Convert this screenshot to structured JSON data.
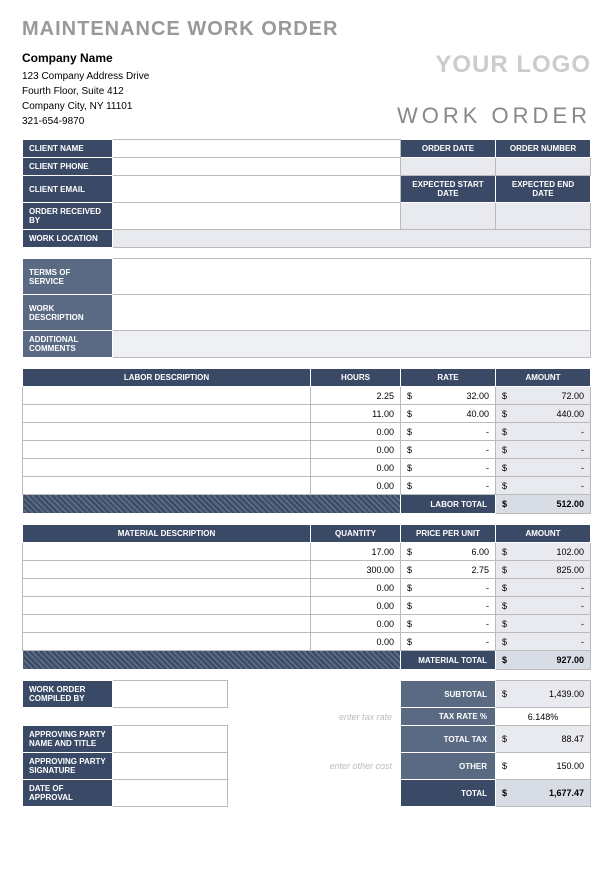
{
  "title": "MAINTENANCE WORK ORDER",
  "company": {
    "name": "Company Name",
    "addr1": "123 Company Address Drive",
    "addr2": "Fourth Floor, Suite 412",
    "addr3": "Company City, NY 11101",
    "phone": "321-654-9870"
  },
  "logo": "YOUR LOGO",
  "work_order": "WORK ORDER",
  "labels": {
    "client_name": "CLIENT NAME",
    "client_phone": "CLIENT PHONE",
    "client_email": "CLIENT EMAIL",
    "order_received": "ORDER RECEIVED BY",
    "work_location": "WORK LOCATION",
    "order_date": "ORDER DATE",
    "order_number": "ORDER NUMBER",
    "exp_start": "EXPECTED START DATE",
    "exp_end": "EXPECTED END DATE",
    "terms": "TERMS OF SERVICE",
    "work_desc": "WORK DESCRIPTION",
    "add_comments": "ADDITIONAL COMMENTS",
    "labor_desc": "LABOR DESCRIPTION",
    "hours": "HOURS",
    "rate": "RATE",
    "amount": "AMOUNT",
    "labor_total": "LABOR TOTAL",
    "material_desc": "MATERIAL DESCRIPTION",
    "quantity": "QUANTITY",
    "ppu": "PRICE PER UNIT",
    "material_total": "MATERIAL TOTAL",
    "compiled_by": "WORK ORDER COMPILED BY",
    "enter_tax": "enter tax rate",
    "enter_other": "enter other cost",
    "approving_name": "APPROVING PARTY NAME AND TITLE",
    "approving_sig": "APPROVING PARTY SIGNATURE",
    "date_approval": "DATE OF APPROVAL",
    "subtotal": "SUBTOTAL",
    "tax_rate": "TAX RATE %",
    "total_tax": "TOTAL TAX",
    "other": "OTHER",
    "total": "TOTAL"
  },
  "labor": [
    {
      "hours": "2.25",
      "rate": "32.00",
      "amount": "72.00"
    },
    {
      "hours": "11.00",
      "rate": "40.00",
      "amount": "440.00"
    },
    {
      "hours": "0.00",
      "rate": "-",
      "amount": "-"
    },
    {
      "hours": "0.00",
      "rate": "-",
      "amount": "-"
    },
    {
      "hours": "0.00",
      "rate": "-",
      "amount": "-"
    },
    {
      "hours": "0.00",
      "rate": "-",
      "amount": "-"
    }
  ],
  "labor_total": "512.00",
  "material": [
    {
      "qty": "17.00",
      "ppu": "6.00",
      "amount": "102.00"
    },
    {
      "qty": "300.00",
      "ppu": "2.75",
      "amount": "825.00"
    },
    {
      "qty": "0.00",
      "ppu": "-",
      "amount": "-"
    },
    {
      "qty": "0.00",
      "ppu": "-",
      "amount": "-"
    },
    {
      "qty": "0.00",
      "ppu": "-",
      "amount": "-"
    },
    {
      "qty": "0.00",
      "ppu": "-",
      "amount": "-"
    }
  ],
  "material_total": "927.00",
  "totals": {
    "subtotal": "1,439.00",
    "tax_rate": "6.148%",
    "total_tax": "88.47",
    "other": "150.00",
    "total": "1,677.47"
  },
  "dollar": "$"
}
